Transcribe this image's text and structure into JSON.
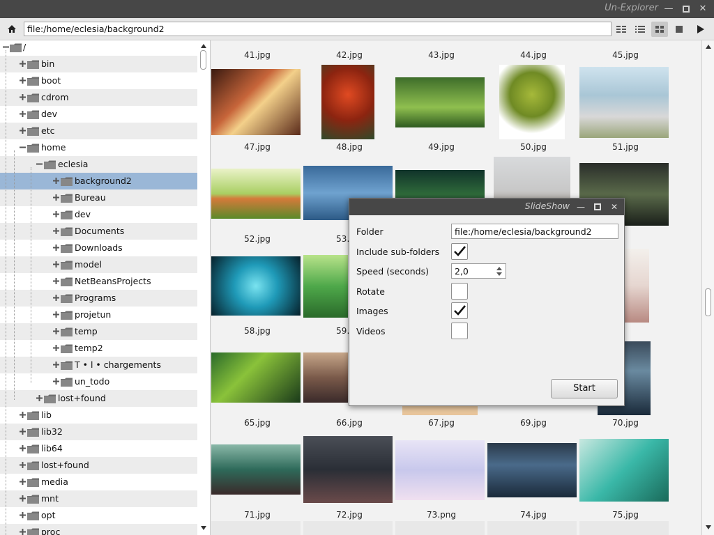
{
  "window": {
    "title": "Un-Explorer",
    "minimize": "—",
    "maximize": "▫",
    "close": "✕"
  },
  "toolbar": {
    "address": "file:/home/eclesia/background2"
  },
  "tree": {
    "root": "/",
    "items": [
      "bin",
      "boot",
      "cdrom",
      "dev",
      "etc",
      "home",
      "eclesia",
      "background2",
      "Bureau",
      "dev",
      "Documents",
      "Downloads",
      "model",
      "NetBeansProjects",
      "Programs",
      "projetun",
      "temp",
      "temp2",
      "T • l • chargements",
      "un_todo",
      "lost+found",
      "lib",
      "lib32",
      "lib64",
      "lost+found",
      "media",
      "mnt",
      "opt",
      "proc"
    ]
  },
  "grid": {
    "captions": [
      [
        "41.jpg",
        "42.jpg",
        "43.jpg",
        "44.jpg",
        "45.jpg"
      ],
      [
        "47.jpg",
        "48.jpg",
        "49.jpg",
        "50.jpg",
        "51.jpg"
      ],
      [
        "52.jpg",
        "53.jpg",
        "",
        "",
        ""
      ],
      [
        "58.jpg",
        "59.jpg",
        "",
        "",
        ""
      ],
      [
        "65.jpg",
        "66.jpg",
        "67.jpg",
        "69.jpg",
        "70.jpg"
      ],
      [
        "71.jpg",
        "72.jpg",
        "73.png",
        "74.jpg",
        "75.jpg"
      ]
    ]
  },
  "dialog": {
    "title": "SlideShow",
    "folder_label": "Folder",
    "folder_value": "file:/home/eclesia/background2",
    "subfolders_label": "Include sub-folders",
    "speed_label": "Speed (seconds)",
    "speed_value": "2,0",
    "rotate_label": "Rotate",
    "images_label": "Images",
    "videos_label": "Videos",
    "start_label": "Start"
  },
  "colors": {
    "titlebar": "#474747",
    "selection": "#9ab7d7",
    "stripe": "#ececec"
  }
}
